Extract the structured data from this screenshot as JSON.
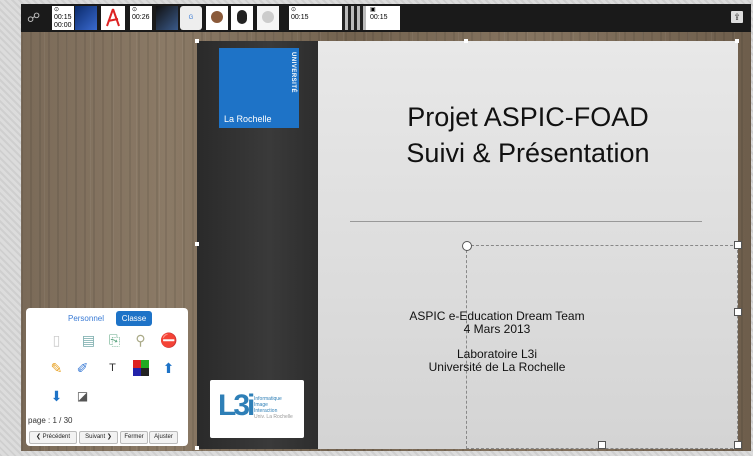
{
  "toolbar": {
    "timestamps": [
      "00:15\n00:00",
      "00:26",
      "00:15",
      "00:15"
    ],
    "share_icon": "share-icon",
    "upload_icon": "upload-icon"
  },
  "slide": {
    "title_line1": "Projet ASPIC-FOAD",
    "title_line2": "Suivi & Présentation",
    "team": "ASPIC e-Education Dream Team",
    "date": "4 Mars 2013",
    "lab": "Laboratoire L3i",
    "university": "Université de La Rochelle",
    "logo_vertical": "UNIVERSITÉ",
    "logo_city": "La Rochelle",
    "l3i_mark": "L3i",
    "l3i_sub1": "Informatique",
    "l3i_sub2": "Image",
    "l3i_sub3": "Interaction",
    "l3i_sub4": "Univ. La Rochelle"
  },
  "tools": {
    "tab_personnel": "Personnel",
    "tab_classe": "Classe",
    "page": "page : 1 / 30",
    "prev": "❮ Précédent",
    "next": "Suivant ❯",
    "close": "Fermer",
    "adjust": "Ajuster"
  },
  "colors": {
    "accent": "#1e73c7",
    "toolbar": "#1a1a1a"
  }
}
